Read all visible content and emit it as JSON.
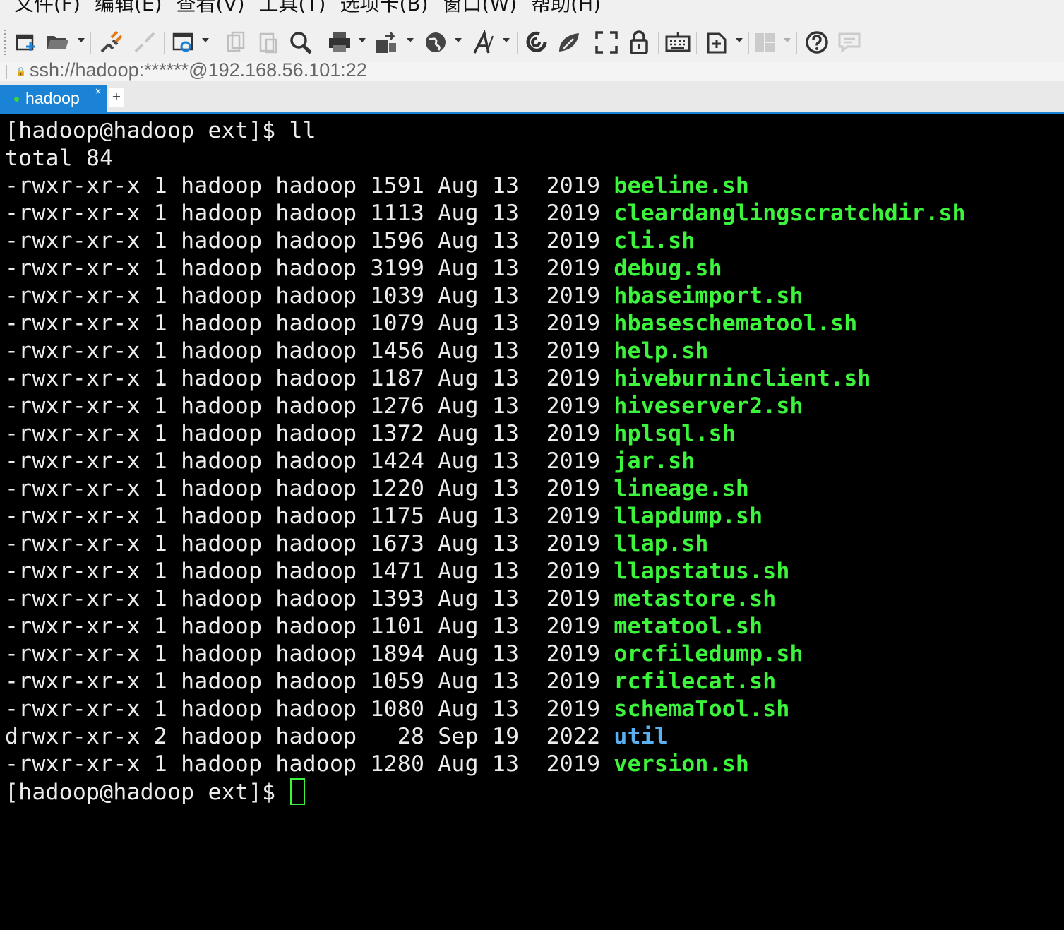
{
  "menu": [
    "文件(F)",
    "编辑(E)",
    "查看(V)",
    "工具(T)",
    "选项卡(B)",
    "窗口(W)",
    "帮助(H)"
  ],
  "toolbar_icons": [
    "new-session-icon",
    "open-folder-icon",
    "connect-icon",
    "disconnect-icon",
    "properties-icon",
    "copy-icon",
    "paste-icon",
    "find-icon",
    "print-icon",
    "transfer-icon",
    "globe-icon",
    "font-icon",
    "swirl-icon",
    "script-icon",
    "fullscreen-icon",
    "lock-icon",
    "keyboard-icon",
    "new-tab-icon",
    "layout-icon",
    "help-icon",
    "chat-icon"
  ],
  "address": "ssh://hadoop:******@192.168.56.101:22",
  "tabs": [
    {
      "label": "hadoop",
      "status_color": "#3cd33c"
    }
  ],
  "new_tab_label": "+",
  "tab_close_label": "×",
  "terminal": {
    "prompt": "[hadoop@hadoop ext]$ ",
    "command": "ll",
    "total_line": "total 84",
    "entries": [
      {
        "perms": "-rwxr-xr-x 1 hadoop hadoop 1591 Aug 13  2019 ",
        "name": "beeline.sh",
        "type": "file"
      },
      {
        "perms": "-rwxr-xr-x 1 hadoop hadoop 1113 Aug 13  2019 ",
        "name": "cleardanglingscratchdir.sh",
        "type": "file"
      },
      {
        "perms": "-rwxr-xr-x 1 hadoop hadoop 1596 Aug 13  2019 ",
        "name": "cli.sh",
        "type": "file"
      },
      {
        "perms": "-rwxr-xr-x 1 hadoop hadoop 3199 Aug 13  2019 ",
        "name": "debug.sh",
        "type": "file"
      },
      {
        "perms": "-rwxr-xr-x 1 hadoop hadoop 1039 Aug 13  2019 ",
        "name": "hbaseimport.sh",
        "type": "file"
      },
      {
        "perms": "-rwxr-xr-x 1 hadoop hadoop 1079 Aug 13  2019 ",
        "name": "hbaseschematool.sh",
        "type": "file"
      },
      {
        "perms": "-rwxr-xr-x 1 hadoop hadoop 1456 Aug 13  2019 ",
        "name": "help.sh",
        "type": "file"
      },
      {
        "perms": "-rwxr-xr-x 1 hadoop hadoop 1187 Aug 13  2019 ",
        "name": "hiveburninclient.sh",
        "type": "file"
      },
      {
        "perms": "-rwxr-xr-x 1 hadoop hadoop 1276 Aug 13  2019 ",
        "name": "hiveserver2.sh",
        "type": "file"
      },
      {
        "perms": "-rwxr-xr-x 1 hadoop hadoop 1372 Aug 13  2019 ",
        "name": "hplsql.sh",
        "type": "file"
      },
      {
        "perms": "-rwxr-xr-x 1 hadoop hadoop 1424 Aug 13  2019 ",
        "name": "jar.sh",
        "type": "file"
      },
      {
        "perms": "-rwxr-xr-x 1 hadoop hadoop 1220 Aug 13  2019 ",
        "name": "lineage.sh",
        "type": "file"
      },
      {
        "perms": "-rwxr-xr-x 1 hadoop hadoop 1175 Aug 13  2019 ",
        "name": "llapdump.sh",
        "type": "file"
      },
      {
        "perms": "-rwxr-xr-x 1 hadoop hadoop 1673 Aug 13  2019 ",
        "name": "llap.sh",
        "type": "file"
      },
      {
        "perms": "-rwxr-xr-x 1 hadoop hadoop 1471 Aug 13  2019 ",
        "name": "llapstatus.sh",
        "type": "file"
      },
      {
        "perms": "-rwxr-xr-x 1 hadoop hadoop 1393 Aug 13  2019 ",
        "name": "metastore.sh",
        "type": "file"
      },
      {
        "perms": "-rwxr-xr-x 1 hadoop hadoop 1101 Aug 13  2019 ",
        "name": "metatool.sh",
        "type": "file"
      },
      {
        "perms": "-rwxr-xr-x 1 hadoop hadoop 1894 Aug 13  2019 ",
        "name": "orcfiledump.sh",
        "type": "file"
      },
      {
        "perms": "-rwxr-xr-x 1 hadoop hadoop 1059 Aug 13  2019 ",
        "name": "rcfilecat.sh",
        "type": "file"
      },
      {
        "perms": "-rwxr-xr-x 1 hadoop hadoop 1080 Aug 13  2019 ",
        "name": "schemaTool.sh",
        "type": "file"
      },
      {
        "perms": "drwxr-xr-x 2 hadoop hadoop   28 Sep 19  2022 ",
        "name": "util",
        "type": "dir"
      },
      {
        "perms": "-rwxr-xr-x 1 hadoop hadoop 1280 Aug 13  2019 ",
        "name": "version.sh",
        "type": "file"
      }
    ],
    "colors": {
      "file": "#3cf43c",
      "dir": "#5ab0f0",
      "text": "#ececec",
      "background": "#000000"
    }
  },
  "colors": {
    "tab_active": "#1a83d6",
    "chrome_bg": "#f0f0f0"
  }
}
